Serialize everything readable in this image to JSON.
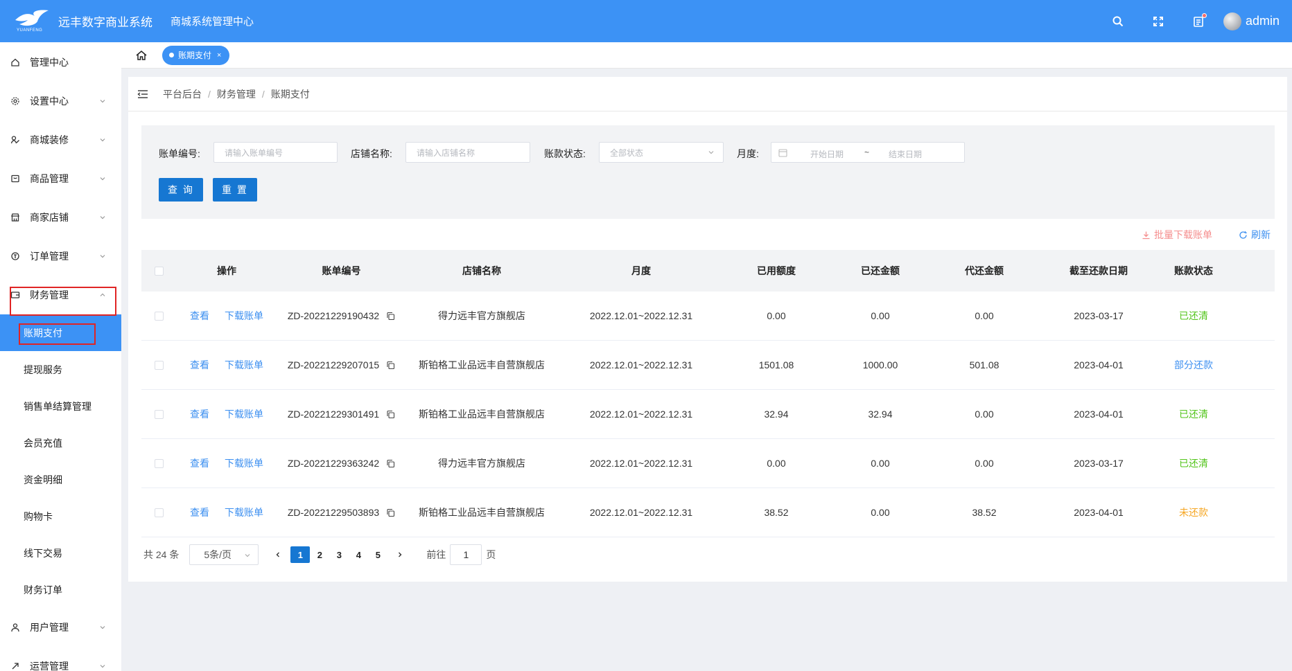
{
  "header": {
    "app_title": "远丰数字商业系统",
    "logo_text": "YUANFENG",
    "subtitle": "商城系统管理中心",
    "username": "admin"
  },
  "sidebar": {
    "items": [
      {
        "label": "管理中心"
      },
      {
        "label": "设置中心"
      },
      {
        "label": "商城装修"
      },
      {
        "label": "商品管理"
      },
      {
        "label": "商家店铺"
      },
      {
        "label": "订单管理"
      },
      {
        "label": "财务管理"
      }
    ],
    "sub_items": [
      {
        "label": "账期支付"
      },
      {
        "label": "提现服务"
      },
      {
        "label": "销售单结算管理"
      },
      {
        "label": "会员充值"
      },
      {
        "label": "资金明细"
      },
      {
        "label": "购物卡"
      },
      {
        "label": "线下交易"
      },
      {
        "label": "财务订单"
      }
    ],
    "bottom_items": [
      {
        "label": "用户管理"
      },
      {
        "label": "运营管理"
      }
    ]
  },
  "tabs": {
    "active_tab": "账期支付",
    "close": "×"
  },
  "breadcrumb": {
    "items": [
      "平台后台",
      "财务管理",
      "账期支付"
    ],
    "separator": "/"
  },
  "filters": {
    "bill_no_label": "账单编号:",
    "bill_no_placeholder": "请输入账单编号",
    "store_label": "店铺名称:",
    "store_placeholder": "请输入店铺名称",
    "status_label": "账款状态:",
    "status_value": "全部状态",
    "month_label": "月度:",
    "start_placeholder": "开始日期",
    "range_sep": "~",
    "end_placeholder": "结束日期",
    "query_button": "查 询",
    "reset_button": "重 置"
  },
  "tools": {
    "batch_download": "批量下载账单",
    "refresh": "刷新",
    "download_color": "#f58e8e",
    "refresh_color": "#3c8ff0"
  },
  "table": {
    "columns": [
      "操作",
      "账单编号",
      "店铺名称",
      "月度",
      "已用额度",
      "已还金额",
      "代还金额",
      "截至还款日期",
      "账款状态"
    ],
    "rows": [
      {
        "view": "查看",
        "download": "下载账单",
        "bill_no": "ZD-20221229190432",
        "store": "得力远丰官方旗舰店",
        "month": "2022.12.01~2022.12.31",
        "used": "0.00",
        "repaid": "0.00",
        "pending": "0.00",
        "due": "2023-03-17",
        "status": "已还清",
        "status_type": "green"
      },
      {
        "view": "查看",
        "download": "下载账单",
        "bill_no": "ZD-20221229207015",
        "store": "斯铂格工业品远丰自营旗舰店",
        "month": "2022.12.01~2022.12.31",
        "used": "1501.08",
        "repaid": "1000.00",
        "pending": "501.08",
        "due": "2023-04-01",
        "status": "部分还款",
        "status_type": "blue"
      },
      {
        "view": "查看",
        "download": "下载账单",
        "bill_no": "ZD-20221229301491",
        "store": "斯铂格工业品远丰自营旗舰店",
        "month": "2022.12.01~2022.12.31",
        "used": "32.94",
        "repaid": "32.94",
        "pending": "0.00",
        "due": "2023-04-01",
        "status": "已还清",
        "status_type": "green"
      },
      {
        "view": "查看",
        "download": "下载账单",
        "bill_no": "ZD-20221229363242",
        "store": "得力远丰官方旗舰店",
        "month": "2022.12.01~2022.12.31",
        "used": "0.00",
        "repaid": "0.00",
        "pending": "0.00",
        "due": "2023-03-17",
        "status": "已还清",
        "status_type": "green"
      },
      {
        "view": "查看",
        "download": "下载账单",
        "bill_no": "ZD-20221229503893",
        "store": "斯铂格工业品远丰自营旗舰店",
        "month": "2022.12.01~2022.12.31",
        "used": "38.52",
        "repaid": "0.00",
        "pending": "38.52",
        "due": "2023-04-01",
        "status": "未还款",
        "status_type": "orange"
      }
    ]
  },
  "pagination": {
    "total": "共 24 条",
    "page_size": "5条/页",
    "pages": [
      "1",
      "2",
      "3",
      "4",
      "5"
    ],
    "current": "1",
    "goto_label": "前往",
    "goto_value": "1",
    "goto_suffix": "页"
  },
  "colors": {
    "primary": "#3c92f5",
    "button": "#1677d2",
    "highlight_box": "#e02424"
  }
}
